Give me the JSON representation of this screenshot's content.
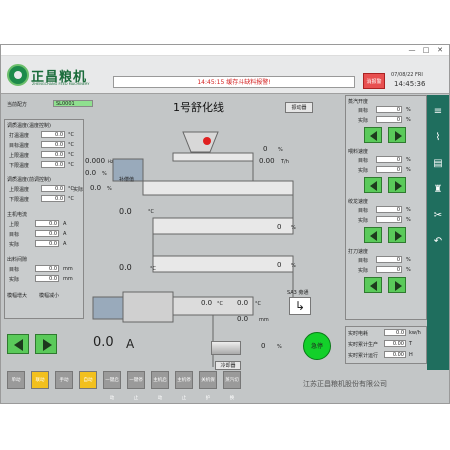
{
  "window": {
    "controls": {
      "minimize": "—",
      "maximize": "□",
      "close": "✕"
    }
  },
  "header": {
    "brand": "正昌粮机",
    "brand_sub": "ZHENGCHANG FEED MACHINERY",
    "alarm_text": "14:45:15   缓存斗缺料报警!",
    "alarm_button": "消报警",
    "date": "07/08/22 FRI",
    "time": "14:45:36"
  },
  "recipe": {
    "label": "当前配方",
    "value": "SL0001"
  },
  "line_title": "1号舒化线",
  "start_button": "振动器",
  "left": {
    "sec1_title": "调质温度(温度控制)",
    "sec1_rows": [
      {
        "label": "打温温度",
        "value": "0.0",
        "unit": "°C"
      },
      {
        "label": "目标温度",
        "value": "0.0",
        "unit": "°C"
      },
      {
        "label": "上限温度",
        "value": "0.0",
        "unit": "°C"
      },
      {
        "label": "下限温度",
        "value": "0.0",
        "unit": "°C"
      }
    ],
    "sec2_title": "调质温度(前调控制)",
    "sec2_rows": [
      {
        "label": "上限温度",
        "value": "0.0",
        "unit": "°C"
      },
      {
        "label": "下限温度",
        "value": "0.0",
        "unit": "°C"
      }
    ],
    "sec3_title": "主机电流",
    "sec3_rows": [
      {
        "label": "上限",
        "value": "0.0",
        "unit": "A"
      },
      {
        "label": "目标",
        "value": "0.0",
        "unit": "A"
      },
      {
        "label": "实际",
        "value": "0.0",
        "unit": "A"
      }
    ],
    "sec4_title": "出料间隙",
    "sec4_rows": [
      {
        "label": "目标",
        "value": "0.0",
        "unit": "mm"
      },
      {
        "label": "实际",
        "value": "0.0",
        "unit": "mm"
      }
    ],
    "gap_labels": {
      "inc": "模幅增大",
      "dec": "模幅减小"
    }
  },
  "center": {
    "feeder_rate": "0.000",
    "feeder_unit": "Hz",
    "feeder_pct": "0.0",
    "supplement_label": "补偿值",
    "actual_label": "实际",
    "actual_pct": "0.0",
    "screw_pct": "0",
    "screw_rate": "0.00",
    "screw_unit": "T/h",
    "cond1_temp": "0.0",
    "cond1_unit": "°C",
    "cond1_pct": "0",
    "cond2_pct": "0",
    "cond3_temp": "0.0",
    "cond3_unit": "°C",
    "die_temp1": "0.0",
    "die_temp2": "0.0",
    "die_unit": "°C",
    "die_mm": "0.0",
    "die_mm_unit": "mm",
    "current": "0.0",
    "current_unit": "A",
    "cutter_pct": "0",
    "cooler_label": "冷却器",
    "bypass_label": "SA3 旁通",
    "estop": "急停",
    "pct": "%"
  },
  "right": {
    "s1_title": "蒸汽开度",
    "s1_rows": [
      {
        "label": "目标",
        "value": "0",
        "unit": "%"
      },
      {
        "label": "实际",
        "value": "0",
        "unit": "%"
      }
    ],
    "s2_title": "喂料速度",
    "s2_rows": [
      {
        "label": "目标",
        "value": "0",
        "unit": "%"
      },
      {
        "label": "实际",
        "value": "0",
        "unit": "%"
      }
    ],
    "s3_title": "绞龙速度",
    "s3_rows": [
      {
        "label": "目标",
        "value": "0",
        "unit": "%"
      },
      {
        "label": "实际",
        "value": "0",
        "unit": "%"
      }
    ],
    "s4_title": "打刀速度",
    "s4_rows": [
      {
        "label": "目标",
        "value": "0",
        "unit": "%"
      },
      {
        "label": "实际",
        "value": "0",
        "unit": "%"
      }
    ],
    "stats": [
      {
        "label": "实时电耗",
        "value": "0.0",
        "unit": "kw/h"
      },
      {
        "label": "实时累计生产",
        "value": "0.00",
        "unit": "T"
      },
      {
        "label": "实时累计运行",
        "value": "0.00",
        "unit": "H"
      }
    ]
  },
  "bottom_buttons": [
    {
      "label": "单动",
      "color": "#9a9a9a"
    },
    {
      "label": "联动",
      "color": "#f2c01e"
    },
    {
      "label": "手动",
      "color": "#9a9a9a"
    },
    {
      "label": "自动",
      "color": "#f2c01e"
    },
    {
      "label": "一键启动",
      "color": "#9a9a9a"
    },
    {
      "label": "一键停止",
      "color": "#9a9a9a"
    },
    {
      "label": "主机启动",
      "color": "#9a9a9a"
    },
    {
      "label": "主机停止",
      "color": "#9a9a9a"
    },
    {
      "label": "关机保护",
      "color": "#9a9a9a"
    },
    {
      "label": "蒸汽切换",
      "color": "#9a9a9a"
    }
  ],
  "company": "江苏正昌粮机股份有限公司",
  "sidebar_icons": [
    "sliders-icon",
    "chart-icon",
    "alarm-icon",
    "siren-icon",
    "tools-icon",
    "back-icon"
  ]
}
